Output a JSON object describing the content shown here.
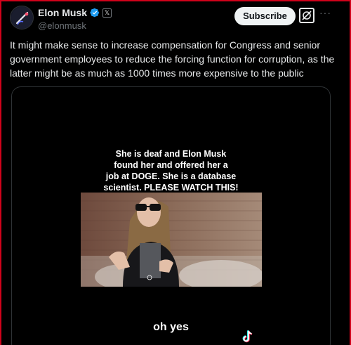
{
  "author": {
    "name": "Elon Musk",
    "handle": "@elonmusk",
    "affiliate_badge": "𝕏"
  },
  "actions": {
    "subscribe_label": "Subscribe",
    "more_label": "···"
  },
  "tweet": {
    "text": "It might make sense to increase compensation for Congress and senior government employees to reduce the forcing function for corruption, as the latter might be as much as 1000 times more expensive to the public"
  },
  "video": {
    "caption_lines": [
      "She is deaf and Elon Musk",
      "found her and offered her a",
      "job at DOGE. She is a database",
      "scientist. PLEASE WATCH THIS!"
    ],
    "subtitle": "oh yes"
  },
  "colors": {
    "background": "#000000",
    "text": "#e7e9ea",
    "secondary_text": "#71767b",
    "verified_blue": "#1d9bf0",
    "subscribe_bg": "#eff3f4",
    "frame_border": "#d0021b"
  },
  "icons": [
    "verified-icon",
    "x-affiliate-badge",
    "grok-icon",
    "more-icon",
    "tiktok-icon"
  ]
}
